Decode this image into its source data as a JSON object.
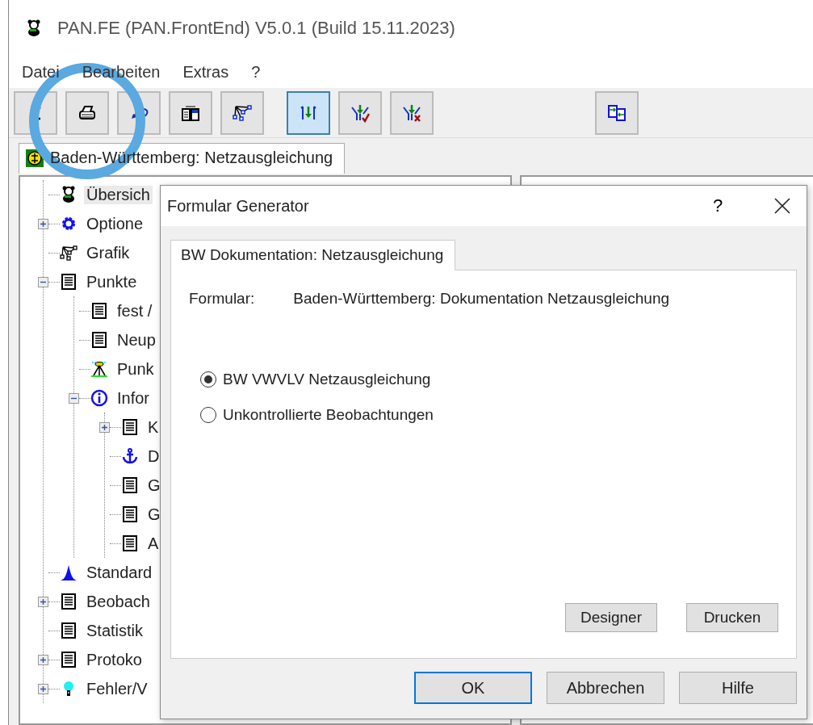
{
  "window": {
    "title": "PAN.FE (PAN.FrontEnd) V5.0.1 (Build 15.11.2023)"
  },
  "menu": [
    "Datei",
    "Bearbeiten",
    "Extras",
    "?"
  ],
  "toolbar": [
    {
      "kind": "reload",
      "pressed": false
    },
    {
      "kind": "print",
      "pressed": false
    },
    {
      "kind": "undo",
      "pressed": false
    },
    {
      "kind": "swap",
      "pressed": false
    },
    {
      "kind": "graph",
      "pressed": false
    },
    {
      "kind": "adjust",
      "pressed": true
    },
    {
      "kind": "adjust-check",
      "pressed": false
    },
    {
      "kind": "adjust-cancel",
      "pressed": false
    }
  ],
  "toolbar_right": [
    {
      "kind": "exchange",
      "pressed": false
    }
  ],
  "document_tab": {
    "label": "Baden-Württemberg: Netzausgleichung"
  },
  "tree": [
    {
      "label": "Übersich",
      "kind": "overview",
      "selected": true
    },
    {
      "label": "Optione",
      "kind": "settings",
      "selected": false,
      "expanded": false
    },
    {
      "label": "Grafik",
      "kind": "graph",
      "selected": false
    },
    {
      "label": "Punkte",
      "kind": "list",
      "selected": false,
      "expanded": true,
      "children": [
        {
          "label": "fest /",
          "kind": "list",
          "selected": false
        },
        {
          "label": "Neup",
          "kind": "list",
          "selected": false
        },
        {
          "label": "Punk",
          "kind": "instrument",
          "selected": false
        },
        {
          "label": "Infor",
          "kind": "info",
          "selected": false,
          "expanded": true,
          "children": [
            {
              "label": "K",
              "kind": "list",
              "selected": false,
              "expanded": false
            },
            {
              "label": "D",
              "kind": "anchor",
              "selected": false
            },
            {
              "label": "G",
              "kind": "list",
              "selected": false
            },
            {
              "label": "G",
              "kind": "list",
              "selected": false
            },
            {
              "label": "A",
              "kind": "list",
              "selected": false
            }
          ]
        }
      ]
    },
    {
      "label": "Standard",
      "kind": "standard",
      "selected": false
    },
    {
      "label": "Beobach",
      "kind": "list",
      "selected": false,
      "expanded": false
    },
    {
      "label": "Statistik",
      "kind": "list",
      "selected": false
    },
    {
      "label": "Protoko",
      "kind": "list",
      "selected": false,
      "expanded": false
    },
    {
      "label": "Fehler/V",
      "kind": "tip",
      "selected": false,
      "expanded": false
    }
  ],
  "dialog": {
    "title": "Formular Generator",
    "help": "?",
    "tab": "BW Dokumentation: Netzausgleichung",
    "form_label": "Formular:",
    "form_value": "Baden-Württemberg: Dokumentation Netzausgleichung",
    "options": [
      {
        "label": "BW VWVLV Netzausgleichung",
        "selected": true
      },
      {
        "label": "Unkontrollierte Beobachtungen",
        "selected": false
      }
    ],
    "panel_buttons": [
      "Designer",
      "Drucken"
    ],
    "buttons": [
      {
        "label": "OK",
        "default": true
      },
      {
        "label": "Abbrechen",
        "default": false
      },
      {
        "label": "Hilfe",
        "default": false
      }
    ]
  }
}
